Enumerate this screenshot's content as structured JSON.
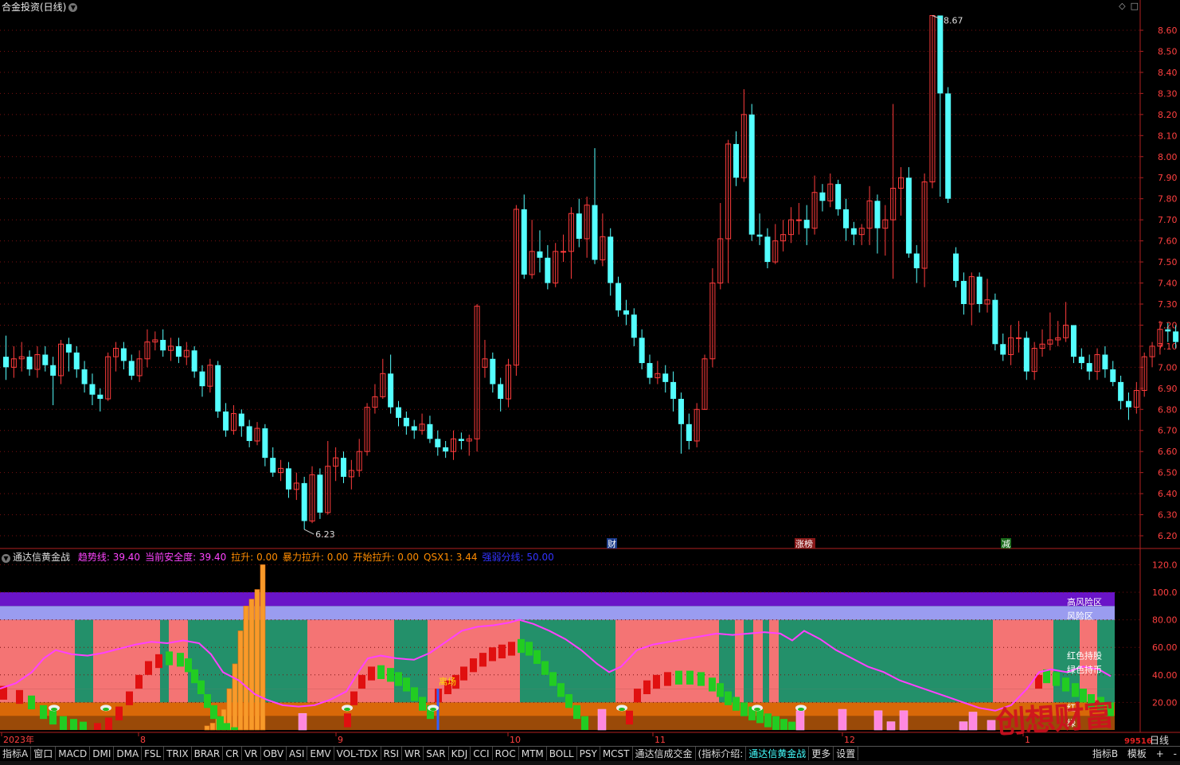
{
  "header": {
    "title": "合金投资(日线)",
    "icons": [
      "diamond-icon",
      "square-icon"
    ]
  },
  "price_axis": {
    "ticks": [
      "8.60",
      "8.50",
      "8.40",
      "8.30",
      "8.20",
      "8.10",
      "8.00",
      "7.90",
      "7.80",
      "7.70",
      "7.60",
      "7.50",
      "7.40",
      "7.30",
      "7.20",
      "7.10",
      "7.00",
      "6.90",
      "6.80",
      "6.70",
      "6.60",
      "6.50",
      "6.40",
      "6.30",
      "6.20"
    ],
    "high_label": "8.67",
    "low_label": "6.23"
  },
  "markers": {
    "cai": "财",
    "zhangbang": "涨榜",
    "jian": "减"
  },
  "indicator": {
    "name": "通达信黄金战",
    "values": [
      {
        "label": "趋势线: 39.40",
        "color": "#ff44ff"
      },
      {
        "label": "当前安全度: 39.40",
        "color": "#ff44ff"
      },
      {
        "label": "拉升: 0.00",
        "color": "#ff8c00"
      },
      {
        "label": "暴力拉升: 0.00",
        "color": "#ff8c00"
      },
      {
        "label": "开始拉升: 0.00",
        "color": "#ff8c00"
      },
      {
        "label": "QSX1: 3.44",
        "color": "#ff8c00"
      },
      {
        "label": "强弱分线: 50.00",
        "color": "#3333ff"
      }
    ],
    "axis_ticks": [
      "120.0",
      "100.0",
      "80.00",
      "60.00",
      "40.00",
      "20.00"
    ],
    "zone_labels": {
      "high_risk": "高风险区",
      "risk": "风险区",
      "red_hold": "红色持股",
      "green_hold": "绿色持币",
      "lixian": "离场",
      "red_hold_short": "红",
      "green_hold_short": "绿"
    }
  },
  "dates": {
    "y2023": "2023年",
    "m8": "8",
    "m9": "9",
    "m10": "10",
    "m11": "11",
    "m12": "12",
    "m1": "1"
  },
  "period": "日线",
  "tabs": [
    "指标A",
    "窗口",
    "MACD",
    "DMI",
    "DMA",
    "FSL",
    "TRIX",
    "BRAR",
    "CR",
    "VR",
    "OBV",
    "ASI",
    "EMV",
    "VOL-TDX",
    "RSI",
    "WR",
    "SAR",
    "KDJ",
    "CCI",
    "ROC",
    "MTM",
    "BOLL",
    "PSY",
    "MCST",
    "通达信成交金",
    "(指标介绍:",
    "通达信黄金战",
    "更多",
    "设置"
  ],
  "active_tab": "通达信黄金战",
  "tab_right": [
    "指标B",
    "模板",
    "+",
    "-"
  ],
  "watermark": "创想财富",
  "watermark_num": "99516",
  "colors": {
    "up": "#ff3c3c",
    "down": "#54ffff",
    "bg": "#000000",
    "grid": "#8b0000"
  },
  "chart_data": {
    "type": "candlestick",
    "ylim": [
      6.15,
      8.68
    ],
    "candles": [
      [
        7.05,
        7.0,
        7.15,
        6.94
      ],
      [
        7.0,
        7.04,
        7.1,
        6.95
      ],
      [
        7.04,
        7.05,
        7.12,
        6.98
      ],
      [
        7.05,
        6.99,
        7.08,
        6.96
      ],
      [
        6.99,
        7.06,
        7.1,
        6.95
      ],
      [
        7.06,
        7.01,
        7.1,
        6.98
      ],
      [
        7.01,
        6.96,
        7.05,
        6.82
      ],
      [
        6.96,
        7.11,
        7.13,
        6.92
      ],
      [
        7.11,
        7.07,
        7.14,
        6.98
      ],
      [
        7.07,
        6.99,
        7.1,
        6.95
      ],
      [
        6.99,
        6.92,
        7.03,
        6.88
      ],
      [
        6.92,
        6.87,
        6.97,
        6.82
      ],
      [
        6.87,
        6.85,
        6.9,
        6.79
      ],
      [
        6.85,
        7.05,
        7.07,
        6.84
      ],
      [
        7.05,
        7.09,
        7.12,
        6.98
      ],
      [
        7.09,
        7.03,
        7.12,
        6.99
      ],
      [
        7.03,
        6.96,
        7.06,
        6.94
      ],
      [
        6.96,
        7.04,
        7.08,
        6.93
      ],
      [
        7.04,
        7.12,
        7.18,
        7.0
      ],
      [
        7.12,
        7.13,
        7.17,
        7.08
      ],
      [
        7.13,
        7.08,
        7.18,
        7.05
      ],
      [
        7.08,
        7.1,
        7.14,
        7.03
      ],
      [
        7.1,
        7.05,
        7.14,
        7.02
      ],
      [
        7.05,
        7.08,
        7.12,
        7.01
      ],
      [
        7.08,
        6.98,
        7.1,
        6.95
      ],
      [
        6.98,
        6.91,
        7.01,
        6.86
      ],
      [
        6.91,
        7.01,
        7.04,
        6.88
      ],
      [
        7.01,
        6.79,
        7.03,
        6.76
      ],
      [
        6.79,
        6.7,
        6.83,
        6.67
      ],
      [
        6.7,
        6.78,
        6.82,
        6.68
      ],
      [
        6.78,
        6.72,
        6.8,
        6.67
      ],
      [
        6.72,
        6.65,
        6.75,
        6.62
      ],
      [
        6.65,
        6.71,
        6.74,
        6.63
      ],
      [
        6.71,
        6.57,
        6.73,
        6.53
      ],
      [
        6.57,
        6.5,
        6.62,
        6.48
      ],
      [
        6.5,
        6.52,
        6.56,
        6.46
      ],
      [
        6.52,
        6.42,
        6.55,
        6.38
      ],
      [
        6.42,
        6.45,
        6.5,
        6.37
      ],
      [
        6.45,
        6.27,
        6.48,
        6.23
      ],
      [
        6.27,
        6.49,
        6.53,
        6.26
      ],
      [
        6.49,
        6.31,
        6.52,
        6.28
      ],
      [
        6.31,
        6.53,
        6.65,
        6.3
      ],
      [
        6.53,
        6.57,
        6.62,
        6.46
      ],
      [
        6.57,
        6.48,
        6.6,
        6.45
      ],
      [
        6.48,
        6.51,
        6.56,
        6.42
      ],
      [
        6.51,
        6.6,
        6.66,
        6.48
      ],
      [
        6.6,
        6.81,
        6.83,
        6.58
      ],
      [
        6.81,
        6.86,
        6.92,
        6.78
      ],
      [
        6.86,
        6.97,
        7.04,
        6.85
      ],
      [
        6.97,
        6.81,
        7.06,
        6.78
      ],
      [
        6.81,
        6.76,
        6.84,
        6.72
      ],
      [
        6.76,
        6.72,
        6.79,
        6.68
      ],
      [
        6.72,
        6.7,
        6.75,
        6.66
      ],
      [
        6.7,
        6.73,
        6.78,
        6.68
      ],
      [
        6.73,
        6.66,
        6.77,
        6.64
      ],
      [
        6.66,
        6.62,
        6.7,
        6.58
      ],
      [
        6.62,
        6.6,
        6.65,
        6.57
      ],
      [
        6.6,
        6.66,
        6.7,
        6.56
      ],
      [
        6.66,
        6.65,
        6.69,
        6.61
      ],
      [
        6.65,
        6.66,
        6.68,
        6.58
      ],
      [
        6.66,
        7.29,
        7.3,
        6.6
      ],
      [
        7.0,
        7.04,
        7.13,
        6.95
      ],
      [
        7.04,
        6.92,
        7.07,
        6.88
      ],
      [
        6.92,
        6.85,
        6.95,
        6.79
      ],
      [
        6.85,
        7.01,
        7.04,
        6.81
      ],
      [
        7.01,
        7.75,
        7.77,
        6.96
      ],
      [
        7.75,
        7.44,
        7.82,
        7.42
      ],
      [
        7.44,
        7.55,
        7.7,
        7.42
      ],
      [
        7.55,
        7.52,
        7.65,
        7.45
      ],
      [
        7.52,
        7.4,
        7.58,
        7.37
      ],
      [
        7.4,
        7.55,
        7.59,
        7.38
      ],
      [
        7.55,
        7.55,
        7.63,
        7.5
      ],
      [
        7.55,
        7.73,
        7.76,
        7.42
      ],
      [
        7.73,
        7.61,
        7.8,
        7.57
      ],
      [
        7.61,
        7.77,
        7.81,
        7.52
      ],
      [
        7.77,
        7.51,
        8.04,
        7.49
      ],
      [
        7.51,
        7.62,
        7.73,
        7.48
      ],
      [
        7.62,
        7.4,
        7.66,
        7.34
      ],
      [
        7.4,
        7.27,
        7.43,
        7.24
      ],
      [
        7.27,
        7.25,
        7.32,
        7.2
      ],
      [
        7.25,
        7.14,
        7.28,
        7.1
      ],
      [
        7.14,
        7.02,
        7.18,
        6.99
      ],
      [
        7.02,
        6.95,
        7.06,
        6.92
      ],
      [
        6.95,
        6.97,
        7.03,
        6.92
      ],
      [
        6.97,
        6.93,
        7.01,
        6.88
      ],
      [
        6.93,
        6.85,
        6.98,
        6.79
      ],
      [
        6.85,
        6.73,
        6.88,
        6.59
      ],
      [
        6.73,
        6.65,
        6.78,
        6.61
      ],
      [
        6.65,
        6.8,
        6.83,
        6.62
      ],
      [
        6.8,
        7.04,
        7.06,
        6.8
      ],
      [
        7.04,
        7.4,
        7.47,
        7.0
      ],
      [
        7.4,
        7.61,
        7.78,
        7.37
      ],
      [
        7.61,
        8.06,
        8.08,
        7.4
      ],
      [
        8.06,
        7.9,
        8.12,
        7.86
      ],
      [
        7.9,
        8.2,
        8.32,
        7.88
      ],
      [
        8.2,
        7.63,
        8.25,
        7.6
      ],
      [
        7.63,
        7.62,
        7.73,
        7.58
      ],
      [
        7.62,
        7.5,
        7.66,
        7.47
      ],
      [
        7.5,
        7.6,
        7.68,
        7.49
      ],
      [
        7.6,
        7.63,
        7.7,
        7.55
      ],
      [
        7.63,
        7.7,
        7.76,
        7.59
      ],
      [
        7.7,
        7.7,
        7.78,
        7.63
      ],
      [
        7.7,
        7.66,
        7.77,
        7.58
      ],
      [
        7.66,
        7.83,
        7.91,
        7.63
      ],
      [
        7.83,
        7.79,
        7.87,
        7.74
      ],
      [
        7.79,
        7.87,
        7.92,
        7.76
      ],
      [
        7.87,
        7.75,
        7.89,
        7.72
      ],
      [
        7.75,
        7.66,
        7.8,
        7.6
      ],
      [
        7.66,
        7.63,
        7.69,
        7.58
      ],
      [
        7.63,
        7.66,
        7.68,
        7.58
      ],
      [
        7.66,
        7.79,
        7.86,
        7.58
      ],
      [
        7.79,
        7.66,
        7.82,
        7.54
      ],
      [
        7.66,
        7.7,
        7.77,
        7.53
      ],
      [
        7.7,
        7.85,
        8.25,
        7.42
      ],
      [
        7.85,
        7.9,
        7.95,
        7.72
      ],
      [
        7.9,
        7.54,
        7.95,
        7.52
      ],
      [
        7.54,
        7.47,
        7.58,
        7.4
      ],
      [
        7.47,
        7.88,
        7.92,
        7.38
      ],
      [
        7.88,
        8.67,
        8.67,
        7.85
      ],
      [
        8.67,
        8.3,
        8.38,
        7.81
      ],
      [
        8.3,
        7.8,
        8.33,
        7.78
      ],
      [
        7.54,
        7.41,
        7.57,
        7.38
      ],
      [
        7.41,
        7.3,
        7.45,
        7.25
      ],
      [
        7.3,
        7.43,
        7.45,
        7.2
      ],
      [
        7.43,
        7.3,
        7.45,
        7.26
      ],
      [
        7.3,
        7.32,
        7.42,
        7.26
      ],
      [
        7.32,
        7.11,
        7.35,
        7.08
      ],
      [
        7.11,
        7.06,
        7.16,
        7.03
      ],
      [
        7.06,
        7.14,
        7.2,
        7.01
      ],
      [
        7.14,
        7.14,
        7.22,
        7.07
      ],
      [
        7.14,
        6.98,
        7.17,
        6.94
      ],
      [
        6.98,
        7.09,
        7.12,
        6.94
      ],
      [
        7.09,
        7.11,
        7.18,
        7.05
      ],
      [
        7.11,
        7.13,
        7.26,
        7.08
      ],
      [
        7.13,
        7.14,
        7.22,
        7.1
      ],
      [
        7.14,
        7.2,
        7.31,
        7.12
      ],
      [
        7.2,
        7.05,
        7.2,
        7.02
      ],
      [
        7.05,
        7.02,
        7.09,
        6.99
      ],
      [
        7.02,
        6.98,
        7.06,
        6.94
      ],
      [
        6.98,
        7.06,
        7.09,
        6.94
      ],
      [
        7.06,
        6.99,
        7.1,
        6.95
      ],
      [
        6.99,
        6.93,
        7.03,
        6.91
      ],
      [
        6.93,
        6.84,
        6.96,
        6.8
      ],
      [
        6.84,
        6.81,
        6.88,
        6.75
      ],
      [
        6.81,
        6.89,
        6.93,
        6.78
      ],
      [
        6.89,
        7.05,
        7.07,
        6.86
      ],
      [
        7.05,
        7.1,
        7.12,
        7.0
      ],
      [
        7.1,
        7.18,
        7.22,
        7.06
      ],
      [
        7.18,
        7.17,
        7.21,
        7.12
      ],
      [
        7.17,
        7.12,
        7.2,
        7.09
      ],
      [
        7.12,
        6.97,
        7.18,
        6.94
      ],
      [
        6.97,
        6.9,
        7.0,
        6.86
      ],
      [
        6.9,
        6.97,
        7.02,
        6.88
      ],
      [
        6.97,
        7.08,
        7.1,
        6.95
      ],
      [
        7.08,
        6.97,
        7.09,
        6.93
      ],
      [
        6.97,
        6.83,
        7.03,
        6.82
      ]
    ]
  }
}
